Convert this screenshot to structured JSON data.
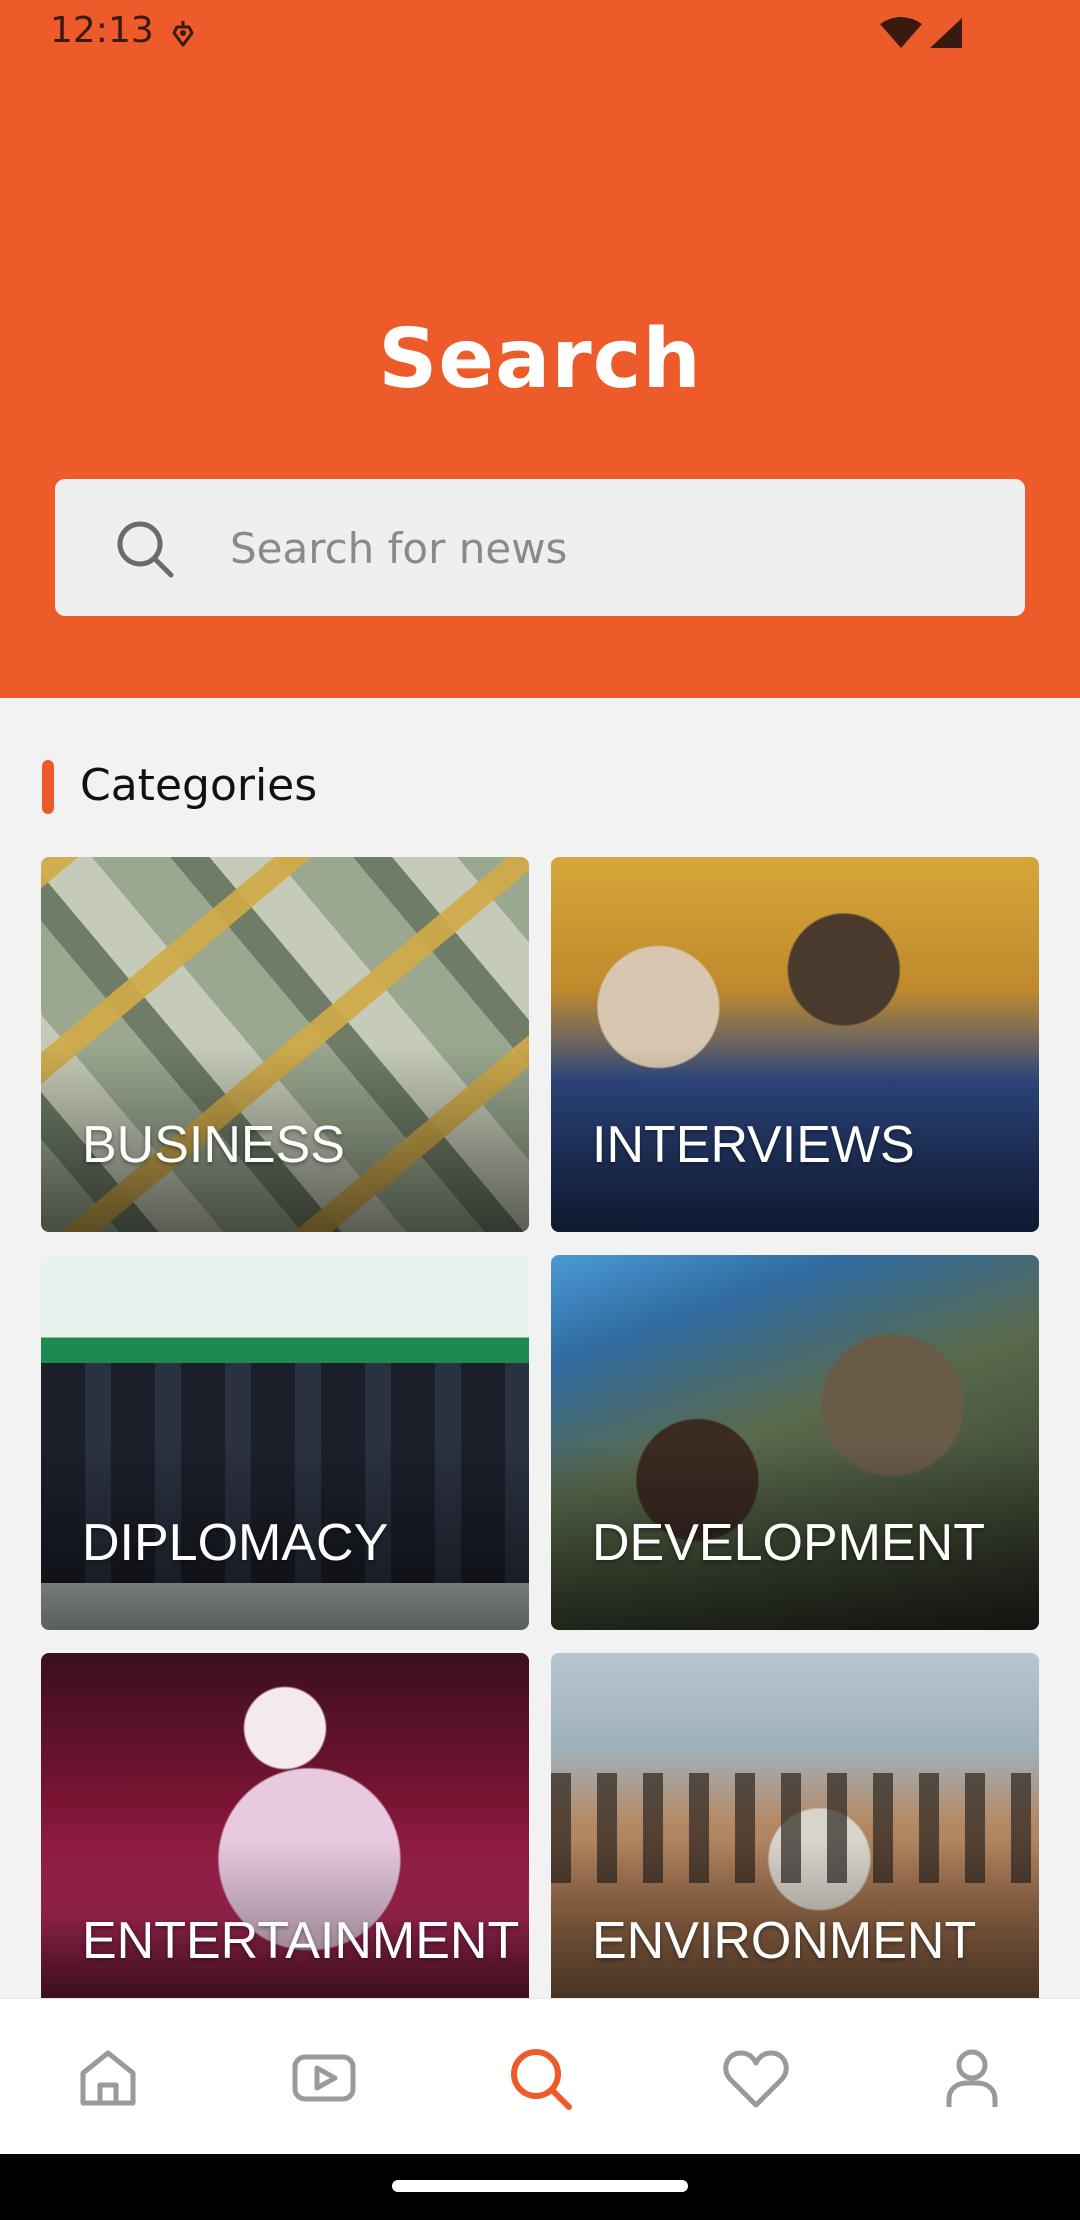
{
  "status_bar": {
    "time": "12:13",
    "icons": [
      "notification-icon",
      "wifi-icon",
      "signal-icon"
    ]
  },
  "header": {
    "title": "Search",
    "background_color": "#ee5b2b"
  },
  "search": {
    "placeholder": "Search for news",
    "value": "",
    "icon": "search-icon"
  },
  "categories": {
    "title": "Categories",
    "accent_color": "#ee5b2b",
    "items": [
      {
        "label": "BUSINESS"
      },
      {
        "label": "INTERVIEWS"
      },
      {
        "label": "DIPLOMACY"
      },
      {
        "label": "DEVELOPMENT"
      },
      {
        "label": "ENTERTAINMENT"
      },
      {
        "label": "ENVIRONMENT"
      }
    ]
  },
  "bottom_nav": {
    "items": [
      {
        "icon": "home-icon",
        "active": false
      },
      {
        "icon": "video-icon",
        "active": false
      },
      {
        "icon": "search-icon",
        "active": true
      },
      {
        "icon": "heart-icon",
        "active": false
      },
      {
        "icon": "profile-icon",
        "active": false
      }
    ],
    "active_color": "#ee5b2b",
    "inactive_color": "#9a9a9a"
  }
}
